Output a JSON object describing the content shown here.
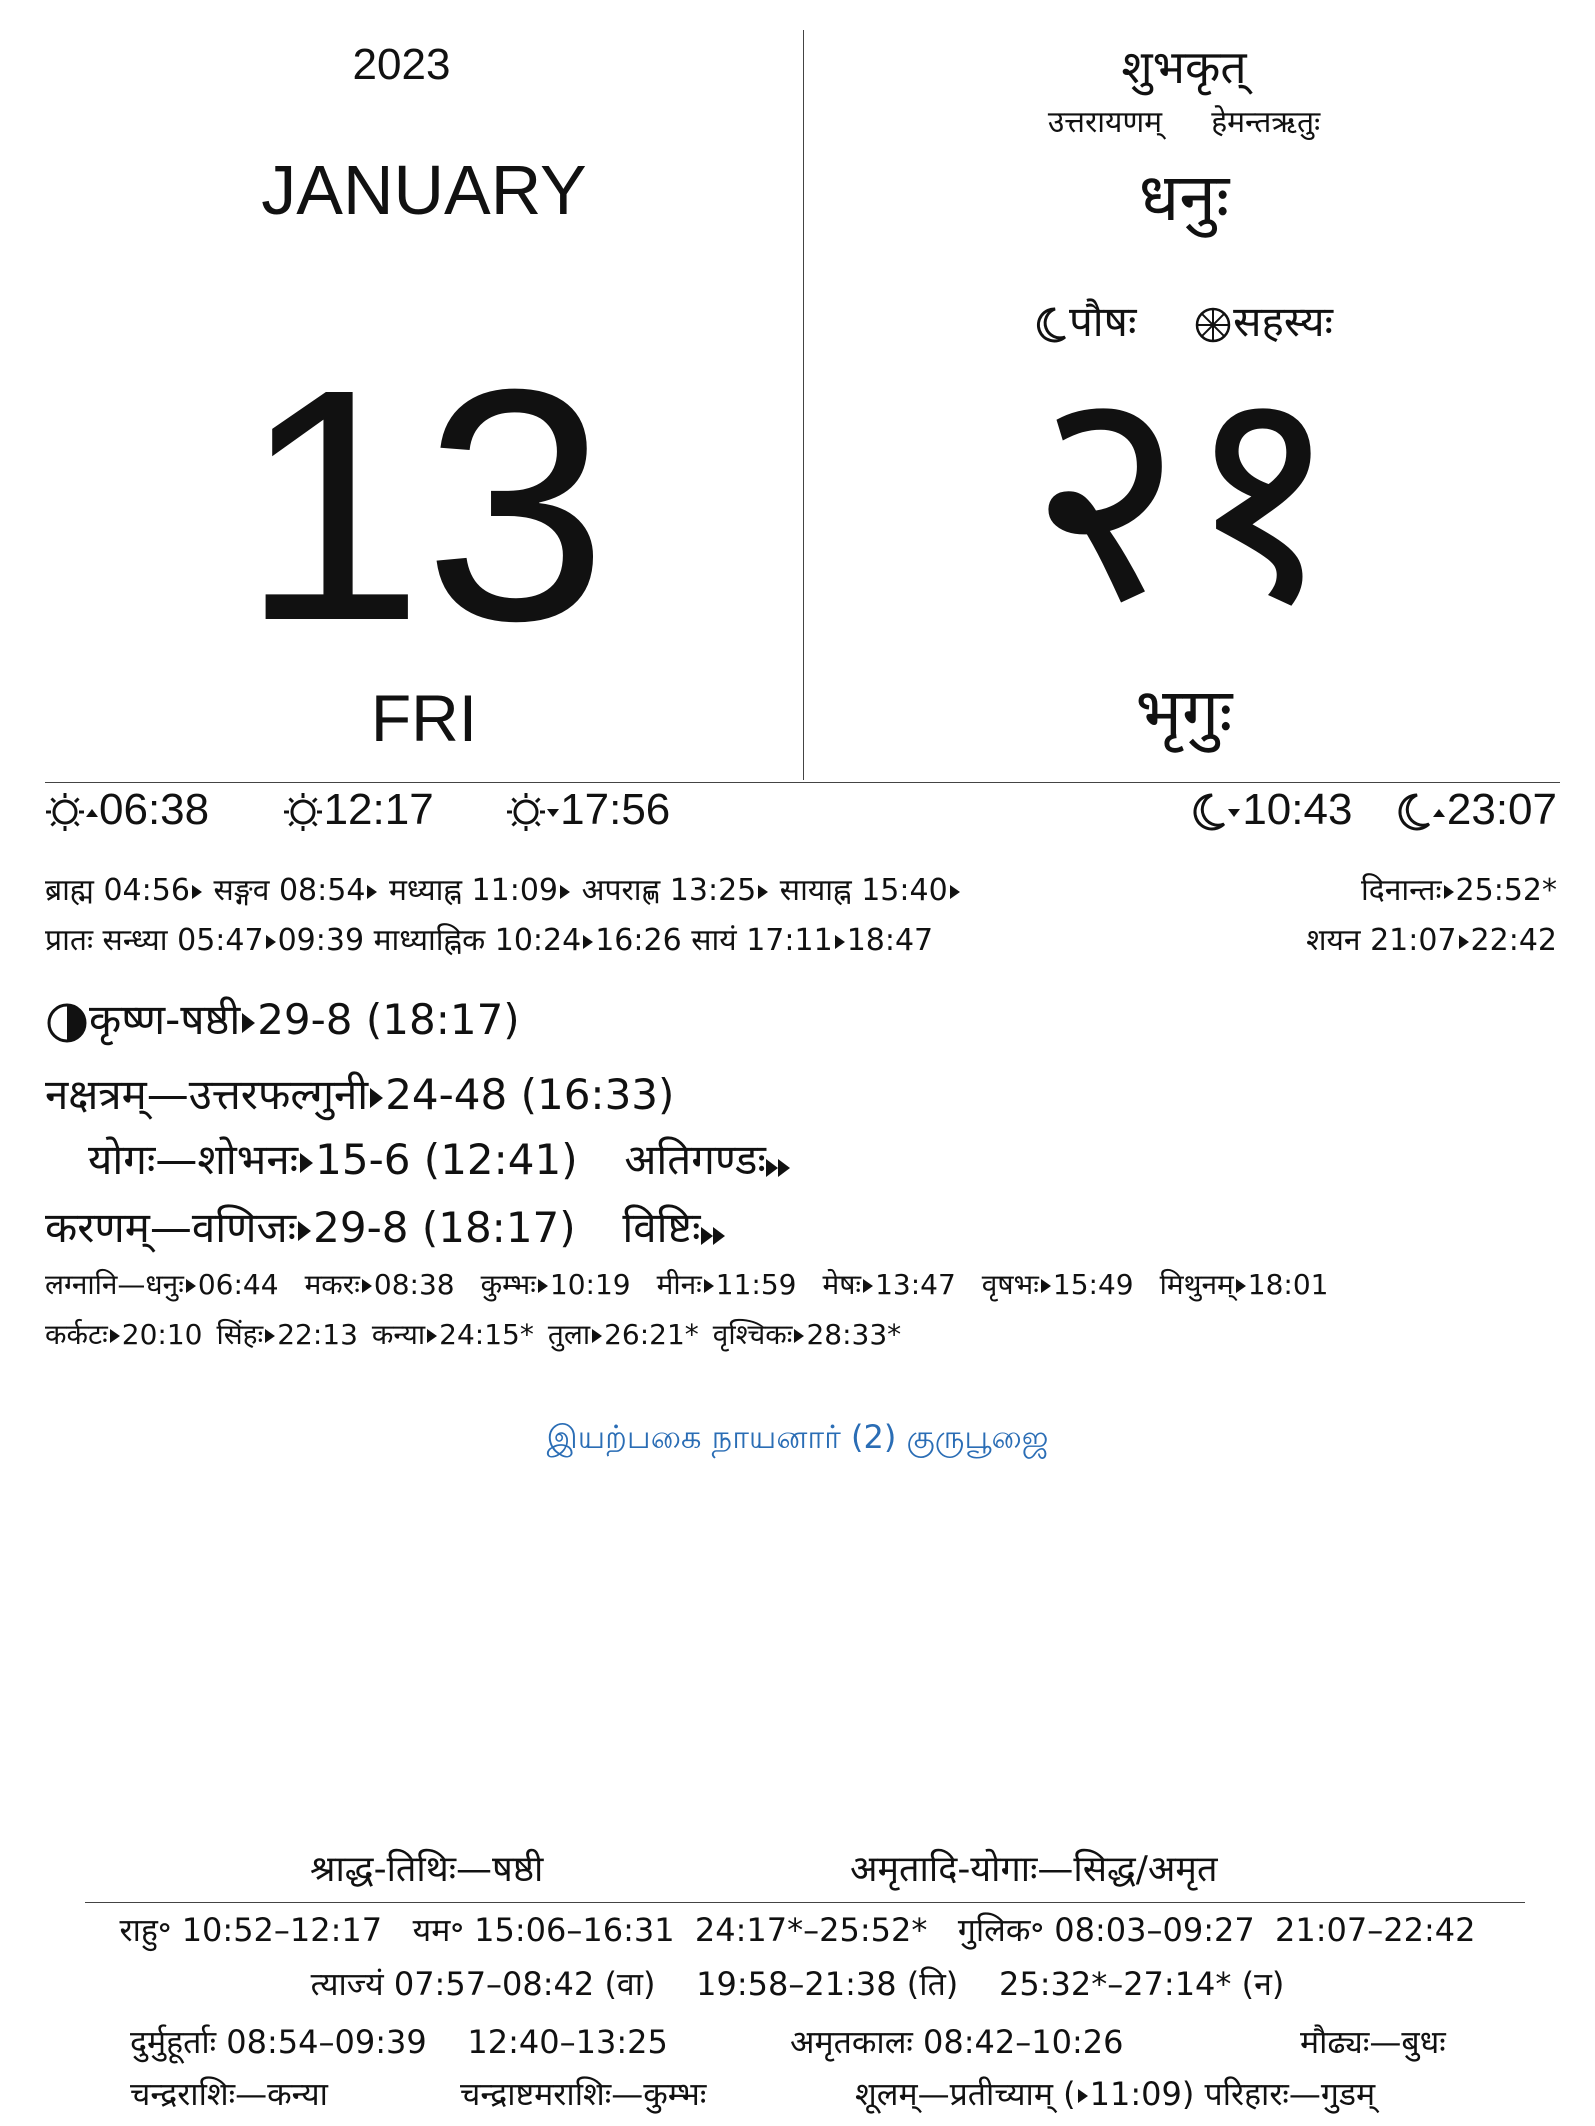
{
  "left": {
    "year": "2023",
    "month": "JANUARY",
    "day": "13",
    "weekday": "FRI"
  },
  "right": {
    "samvatsara": "शुभकृत्",
    "ayana": "उत्तरायणम्",
    "ritu": "हेमन्तऋतुः",
    "solar_month": "धनुः",
    "lunar_month": "पौषः",
    "sauramana_month": "सहस्यः",
    "day_number": "२१",
    "weekday": "भृगुः"
  },
  "sun_moon": {
    "sunrise": "06:38",
    "noon": "12:17",
    "sunset": "17:56",
    "moonset": "10:43",
    "moonrise": "23:07"
  },
  "muhurta": {
    "brahma": "ब्राह्म 04:56",
    "sangava": "सङ्गव 08:54",
    "madhyahna": "मध्याह्न 11:09",
    "aparahna": "अपराह्ण 13:25",
    "sayahna": "सायाह्न 15:40",
    "dinanta_label": "दिनान्तः",
    "dinanta_time": "25:52*",
    "pratah_label": "प्रातः सन्ध्या 05:47",
    "pratah_end": "09:39",
    "madhyahnika_label": "माध्याह्निक 10:24",
    "madhyahnika_end": "16:26",
    "sayam_label": "सायं 17:11",
    "sayam_end": "18:47",
    "shayana_label": "शयन 21:07",
    "shayana_end": "22:42"
  },
  "panchanga": {
    "tithi": "कृष्ण-षष्ठी",
    "tithi_end": "29-8 (18:17)",
    "nakshatra": "नक्षत्रम्—उत्तरफल्गुनी",
    "nakshatra_end": "24-48 (16:33)",
    "yoga": "योगः—शोभनः",
    "yoga_end": "15-6 (12:41)",
    "yoga_next": "अतिगण्डः",
    "karana": "करणम्—वणिजः",
    "karana_end": "29-8 (18:17)",
    "karana_next": "विष्टिः"
  },
  "lagna_row1": [
    {
      "label": "लग्नानि—धनुः",
      "time": "06:44"
    },
    {
      "label": "मकरः",
      "time": "08:38"
    },
    {
      "label": "कुम्भः",
      "time": "10:19"
    },
    {
      "label": "मीनः",
      "time": "11:59"
    },
    {
      "label": "मेषः",
      "time": "13:47"
    },
    {
      "label": "वृषभः",
      "time": "15:49"
    },
    {
      "label": "मिथुनम्",
      "time": "18:01"
    }
  ],
  "lagna_row2": [
    {
      "label": "कर्कटः",
      "time": "20:10"
    },
    {
      "label": "सिंहः",
      "time": "22:13"
    },
    {
      "label": "कन्या",
      "time": "24:15*"
    },
    {
      "label": "तुला",
      "time": "26:21*"
    },
    {
      "label": "वृश्चिकः",
      "time": "28:33*"
    }
  ],
  "festival": "இயற்பகை நாயனார் (2) குருபூஜை",
  "footer": {
    "shraddha": "श्राद्ध-तिथिः—षष्ठी",
    "amritadi": "अमृतादि-योगाः—सिद्ध/अमृत",
    "line1": "राहु॰ 10:52–12:17   यम॰ 15:06–16:31  24:17*–25:52*   गुलिक॰ 08:03–09:27  21:07–22:42",
    "line2": "त्याज्यं 07:57–08:42 (वा)    19:58–21:38 (ति)    25:32*–27:14* (न)",
    "durmuhurta": "दुर्मुहूर्ताः 08:54–09:39    12:40–13:25",
    "amritakala": "अमृतकालः 08:42–10:26",
    "maudhya": "मौढ्यः—बुधः",
    "chandrarashi": "चन्द्रराशिः—कन्या",
    "chandrashtama": "चन्द्राष्टमराशिः—कुम्भः",
    "shulam": "शूलम्—प्रतीच्याम् (",
    "shulam_time": "11:09)",
    "parihara": "परिहारः—गुडम्"
  },
  "colors": {
    "festival": "#2a6db5",
    "text": "#111111"
  }
}
